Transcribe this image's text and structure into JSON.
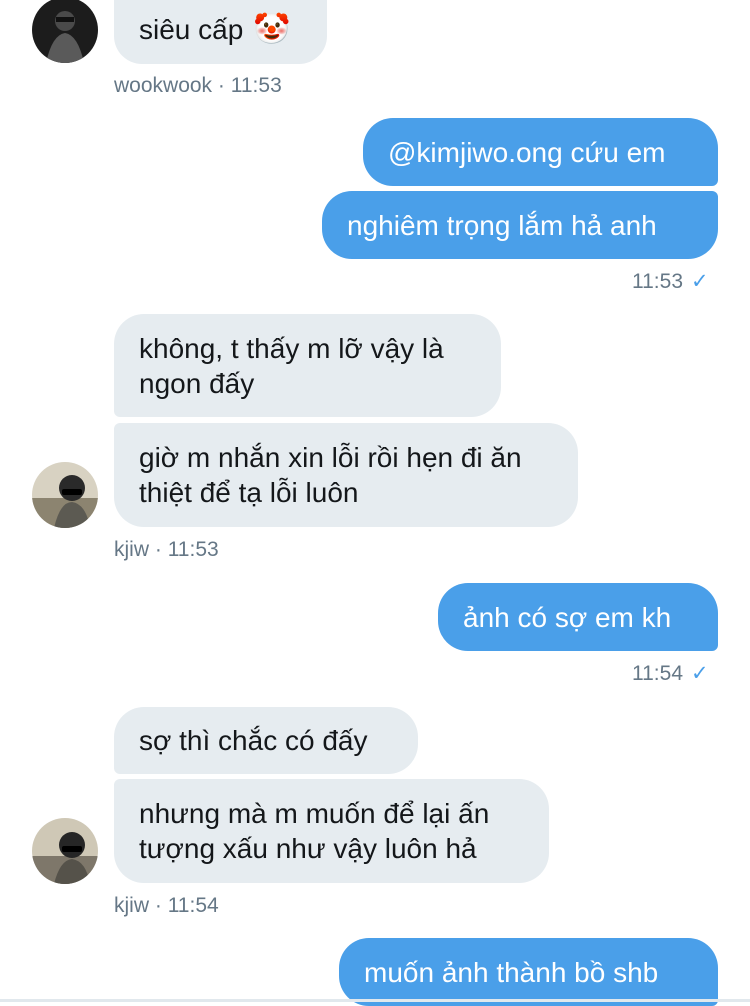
{
  "messages": {
    "m1": {
      "text": "siêu cấp",
      "emoji": "🤡"
    },
    "m1_meta": {
      "user": "wookwook",
      "sep": "·",
      "time": "11:53"
    },
    "m2": {
      "text": "@kimjiwo.ong cứu em"
    },
    "m3": {
      "text": "nghiêm trọng lắm hả anh"
    },
    "m3_meta": {
      "time": "11:53",
      "check": "✓"
    },
    "m4": {
      "line1": "không, t thấy m lỡ vậy là",
      "line2": "ngon đấy"
    },
    "m5": {
      "line1": "giờ m nhắn xin lỗi rồi hẹn đi ăn",
      "line2": "thiệt để tạ lỗi luôn"
    },
    "m5_meta": {
      "user": "kjiw",
      "sep": "·",
      "time": "11:53"
    },
    "m6": {
      "text": "ảnh có sợ em kh"
    },
    "m6_meta": {
      "time": "11:54",
      "check": "✓"
    },
    "m7": {
      "text": "sợ thì chắc có đấy"
    },
    "m8": {
      "line1": "nhưng mà m muốn để lại ấn",
      "line2": "tượng xấu như vậy luôn hả"
    },
    "m8_meta": {
      "user": "kjiw",
      "sep": "·",
      "time": "11:54"
    },
    "m9": {
      "text": "muốn ảnh thành bồ shb"
    }
  },
  "colors": {
    "outgoing": "#4a9fe9",
    "incoming": "#e6ecf0",
    "meta": "#657786"
  },
  "icons": {
    "avatar1": "avatar-wookwook",
    "avatar2": "avatar-kjiw",
    "check": "check-icon"
  }
}
